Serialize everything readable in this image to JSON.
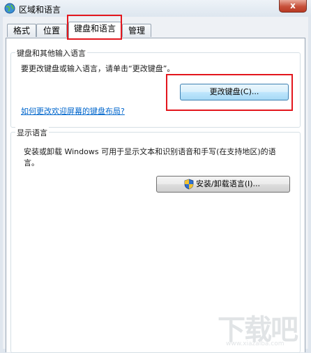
{
  "window": {
    "title": "区域和语言",
    "close_label": "x"
  },
  "tabs": [
    {
      "label": "格式",
      "active": false
    },
    {
      "label": "位置",
      "active": false
    },
    {
      "label": "键盘和语言",
      "active": true
    },
    {
      "label": "管理",
      "active": false
    }
  ],
  "keyboard_group": {
    "title": "键盘和其他输入语言",
    "instruction": "要更改键盘或输入语言，请单击“更改键盘”。",
    "change_button": "更改键盘(C)...",
    "help_link": "如何更改欢迎屏幕的键盘布局?"
  },
  "display_group": {
    "title": "显示语言",
    "instruction_line1": "安装或卸载 Windows 可用于显示文本和识别语音和手写(在支持地区)的语",
    "instruction_line2": "言。",
    "install_button": "安装/卸载语言(I)..."
  },
  "watermark": {
    "main": "下载吧",
    "url": "www.xiazaiba.com"
  },
  "colors": {
    "highlight": "#e3161d",
    "link": "#0066cc"
  }
}
